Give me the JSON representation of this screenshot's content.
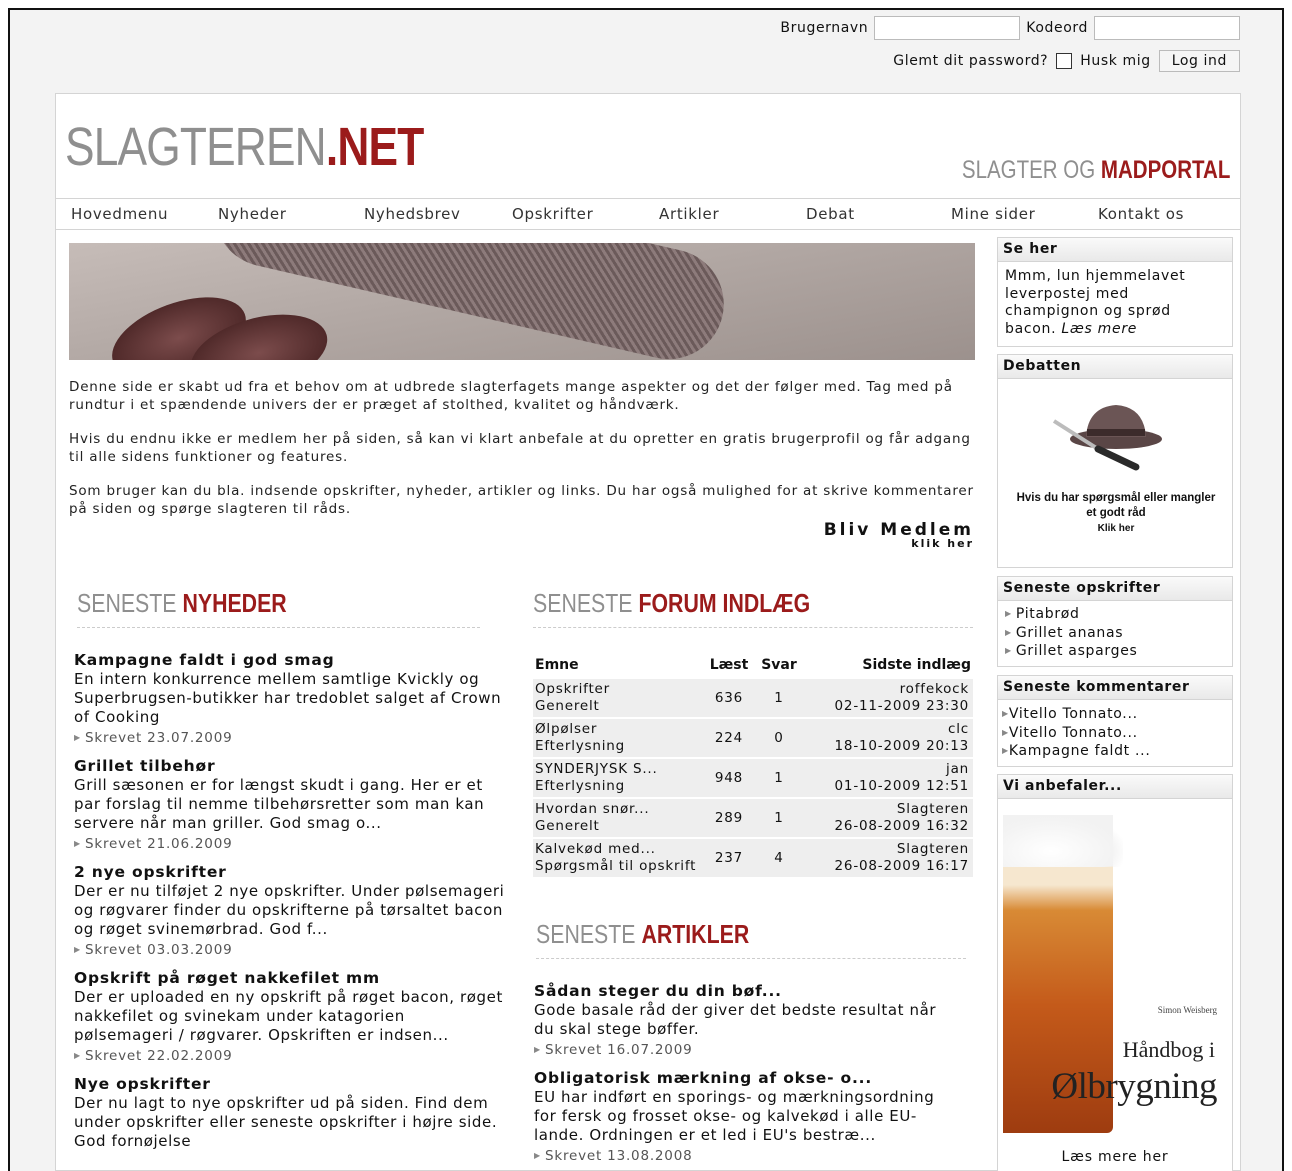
{
  "login": {
    "username_label": "Brugernavn",
    "password_label": "Kodeord",
    "forgot": "Glemt dit password?",
    "remember": "Husk mig",
    "button": "Log ind"
  },
  "header": {
    "logo_part1": "SLAGTEREN",
    "logo_part2": ".NET",
    "tagline_part1": "SLAGTER OG ",
    "tagline_part2": "MADPORTAL"
  },
  "nav": [
    "Hovedmenu",
    "Nyheder",
    "Nyhedsbrev",
    "Opskrifter",
    "Artikler",
    "Debat",
    "Mine sider",
    "Kontakt os"
  ],
  "intro": {
    "p1": "Denne side er skabt ud fra et behov om at udbrede slagterfagets mange aspekter og det der følger med. Tag med på rundtur i et spændende univers der er præget af stolthed, kvalitet og håndværk.",
    "p2": "Hvis du endnu ikke er medlem her på siden, så kan vi klart anbefale at du opretter en gratis brugerprofil og får adgang til alle sidens funktioner og features.",
    "p3": "Som bruger kan du bla. indsende opskrifter, nyheder, artikler og links. Du har også mulighed for at skrive kommentarer på siden og spørge slagteren til råds.",
    "cta": "Bliv Medlem",
    "cta_sub": "klik her"
  },
  "news": {
    "heading_grey": "SENESTE ",
    "heading_red": "NYHEDER",
    "items": [
      {
        "title": "Kampagne faldt i god smag",
        "text": "En intern konkurrence mellem samtlige Kvickly og Superbrugsen-butikker har tredoblet salget af Crown of Cooking",
        "date": "Skrevet 23.07.2009"
      },
      {
        "title": "Grillet tilbehør",
        "text": "Grill sæsonen er for længst skudt i gang. Her er et par forslag til nemme tilbehørsretter som man kan servere når man griller. God smag o...",
        "date": "Skrevet 21.06.2009"
      },
      {
        "title": "2 nye opskrifter",
        "text": "Der er nu tilføjet 2 nye opskrifter. Under pølsemageri og røgvarer finder du opskrifterne på tørsaltet bacon og røget svinemørbrad. God f...",
        "date": "Skrevet 03.03.2009"
      },
      {
        "title": "Opskrift på røget nakkefilet mm",
        "text": "Der er uploaded en ny opskrift på røget bacon, røget nakkefilet og svinekam under katagorien pølsemageri / røgvarer. Opskriften er indsen...",
        "date": "Skrevet 22.02.2009"
      },
      {
        "title": "Nye opskrifter",
        "text": "Der nu lagt to nye opskrifter ud på siden. Find dem under opskrifter eller seneste opskrifter i højre side. God fornøjelse",
        "date": ""
      }
    ]
  },
  "forum": {
    "heading_grey": "SENESTE ",
    "heading_red": "FORUM INDLÆG",
    "columns": [
      "Emne",
      "Læst",
      "Svar",
      "Sidste indlæg"
    ],
    "rows": [
      {
        "topic": "Opskrifter",
        "category": "Generelt",
        "read": "636",
        "replies": "1",
        "user": "roffekock",
        "date": "02-11-2009 23:30"
      },
      {
        "topic": "Ølpølser",
        "category": "Efterlysning",
        "read": "224",
        "replies": "0",
        "user": "clc",
        "date": "18-10-2009 20:13"
      },
      {
        "topic": "SYNDERJYSK S...",
        "category": "Efterlysning",
        "read": "948",
        "replies": "1",
        "user": "jan",
        "date": "01-10-2009 12:51"
      },
      {
        "topic": "Hvordan snør...",
        "category": "Generelt",
        "read": "289",
        "replies": "1",
        "user": "Slagteren",
        "date": "26-08-2009 16:32"
      },
      {
        "topic": "Kalvekød med...",
        "category": "Spørgsmål til opskrift",
        "read": "237",
        "replies": "4",
        "user": "Slagteren",
        "date": "26-08-2009 16:17"
      }
    ]
  },
  "articles": {
    "heading_grey": "SENESTE ",
    "heading_red": "ARTIKLER",
    "items": [
      {
        "title": "Sådan steger du din bøf...",
        "text": "Gode basale råd der giver det bedste resultat når du skal stege bøffer.",
        "date": "Skrevet 16.07.2009"
      },
      {
        "title": "Obligatorisk mærkning af okse- o...",
        "text": "EU har indført en sporings- og mærkningsordning for fersk og frosset okse- og kalvekød i alle EU-lande. Ordningen er et led i EU's bestræ...",
        "date": "Skrevet 13.08.2008"
      }
    ]
  },
  "sidebar": {
    "se_her": {
      "title": "Se her",
      "text": "Mmm, lun hjemmelavet leverpostej med champignon og sprød bacon. ",
      "link": "Læs mere"
    },
    "debatten": {
      "title": "Debatten",
      "caption": "Hvis du har spørgsmål eller mangler et godt råd",
      "caption_sub": "Klik her"
    },
    "recipes": {
      "title": "Seneste opskrifter",
      "items": [
        "Pitabrød",
        "Grillet ananas",
        "Grillet asparges"
      ]
    },
    "comments": {
      "title": "Seneste kommentarer",
      "items": [
        "Vitello Tonnato...",
        "Vitello Tonnato...",
        "Kampagne faldt ..."
      ]
    },
    "recommend": {
      "title": "Vi anbefaler...",
      "book_author": "Simon Weisberg",
      "book_title1": "Håndbog i",
      "book_title2": "Ølbrygning",
      "link": "Læs mere her"
    }
  }
}
